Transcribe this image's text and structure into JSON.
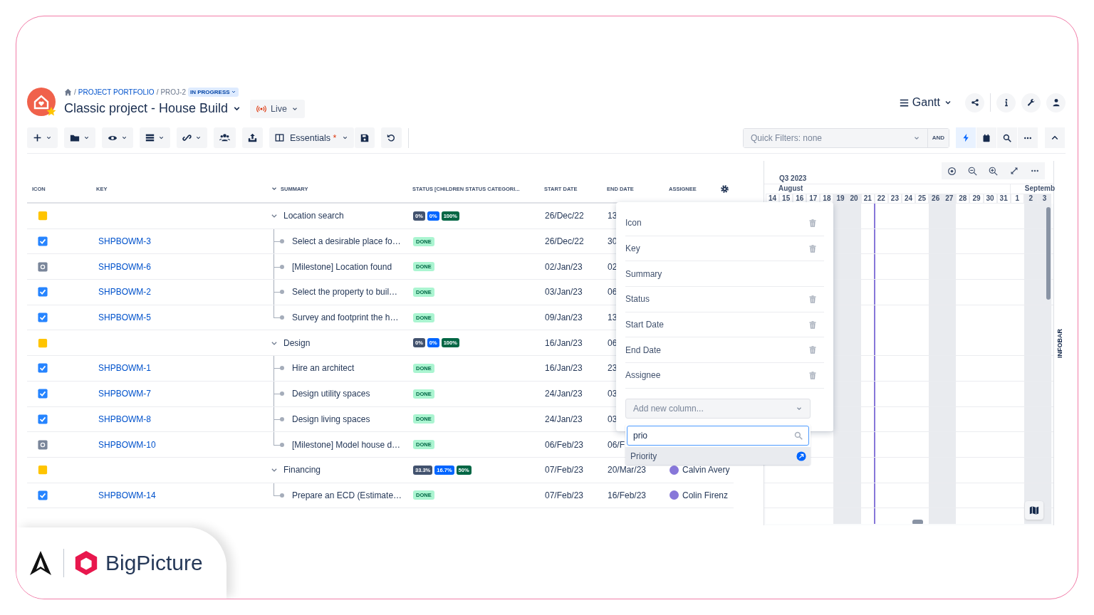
{
  "breadcrumb": {
    "separator": "/",
    "items": [
      "PROJECT PORTFOLIO",
      "PROJ-2"
    ],
    "status": "IN PROGRESS"
  },
  "project": {
    "title": "Classic project - House Build",
    "mode": "Live"
  },
  "view": {
    "label": "Gantt"
  },
  "toolbar": {
    "view_button": "Essentials",
    "view_modified": "*",
    "quick_filters_placeholder": "Quick Filters: none",
    "logic": "AND"
  },
  "table": {
    "columns": [
      {
        "label": "ICON"
      },
      {
        "label": "KEY"
      },
      {
        "label": "SUMMARY"
      },
      {
        "label": "STATUS [CHILDREN STATUS CATEGORI..."
      },
      {
        "label": "START DATE"
      },
      {
        "label": "END DATE"
      },
      {
        "label": "ASSIGNEE"
      }
    ],
    "rows": [
      {
        "kind": "group",
        "summary": "Location search",
        "expanded": true,
        "progress": [
          {
            "text": "0%",
            "color": "#42526e"
          },
          {
            "text": "0%",
            "color": "#0065ff"
          },
          {
            "text": "100%",
            "color": "#006644"
          }
        ],
        "start": "26/Dec/22",
        "end": "13",
        "children": [
          {
            "kind": "task",
            "key": "SHPBOWM-3",
            "summary": "Select a desirable place fo…",
            "status": "DONE",
            "start": "26/Dec/22",
            "end": "30"
          },
          {
            "kind": "milestone",
            "key": "SHPBOWM-6",
            "summary": "[Milestone] Location found",
            "status": "DONE",
            "start": "02/Jan/23",
            "end": "02"
          },
          {
            "kind": "task",
            "key": "SHPBOWM-2",
            "summary": "Select the property to buil…",
            "status": "DONE",
            "start": "03/Jan/23",
            "end": "06"
          },
          {
            "kind": "task",
            "key": "SHPBOWM-5",
            "summary": "Survey and footprint the h…",
            "status": "DONE",
            "start": "09/Jan/23",
            "end": "13"
          }
        ]
      },
      {
        "kind": "group",
        "summary": "Design",
        "expanded": true,
        "progress": [
          {
            "text": "0%",
            "color": "#42526e"
          },
          {
            "text": "0%",
            "color": "#0065ff"
          },
          {
            "text": "100%",
            "color": "#006644"
          }
        ],
        "start": "16/Jan/23",
        "end": "06",
        "children": [
          {
            "kind": "task",
            "key": "SHPBOWM-1",
            "summary": "Hire an architect",
            "status": "DONE",
            "start": "16/Jan/23",
            "end": "23"
          },
          {
            "kind": "task",
            "key": "SHPBOWM-7",
            "summary": "Design utility spaces",
            "status": "DONE",
            "start": "24/Jan/23",
            "end": "03"
          },
          {
            "kind": "task",
            "key": "SHPBOWM-8",
            "summary": "Design living spaces",
            "status": "DONE",
            "start": "24/Jan/23",
            "end": "03"
          },
          {
            "kind": "milestone",
            "key": "SHPBOWM-10",
            "summary": "[Milestone] Model house d…",
            "status": "DONE",
            "start": "06/Feb/23",
            "end": "06/F"
          }
        ]
      },
      {
        "kind": "group",
        "summary": "Financing",
        "expanded": true,
        "progress": [
          {
            "text": "33.3%",
            "color": "#42526e"
          },
          {
            "text": "16.7%",
            "color": "#0065ff"
          },
          {
            "text": "50%",
            "color": "#006644"
          }
        ],
        "start": "07/Feb/23",
        "end": "20/Mar/23",
        "assignee": "Calvin Avery",
        "children": [
          {
            "kind": "task",
            "key": "SHPBOWM-14",
            "summary": "Prepare an ECD (Estimate…",
            "status": "DONE",
            "start": "07/Feb/23",
            "end": "16/Feb/23",
            "assignee": "Colin Firenz"
          }
        ]
      }
    ]
  },
  "column_picker": {
    "items": [
      {
        "label": "Icon",
        "removable": true
      },
      {
        "label": "Key",
        "removable": true
      },
      {
        "label": "Summary",
        "removable": false
      },
      {
        "label": "Status",
        "removable": true
      },
      {
        "label": "Start Date",
        "removable": true
      },
      {
        "label": "End Date",
        "removable": true
      },
      {
        "label": "Assignee",
        "removable": true
      }
    ],
    "add_placeholder": "Add new column...",
    "search_value": "prio",
    "options": [
      {
        "label": "Priority",
        "selected": true
      }
    ]
  },
  "gantt": {
    "quarter": "Q3 2023",
    "months": [
      {
        "label": "August",
        "days": [
          {
            "label": "14",
            "weekend": false,
            "today": false
          },
          {
            "label": "15",
            "weekend": false,
            "today": false
          },
          {
            "label": "16",
            "weekend": false,
            "today": false
          },
          {
            "label": "17",
            "weekend": false,
            "today": false
          },
          {
            "label": "18",
            "weekend": false,
            "today": false
          },
          {
            "label": "19",
            "weekend": true,
            "today": false
          },
          {
            "label": "20",
            "weekend": true,
            "today": false
          },
          {
            "label": "21",
            "weekend": false,
            "today": false
          },
          {
            "label": "22",
            "weekend": false,
            "today": true
          },
          {
            "label": "23",
            "weekend": false,
            "today": false
          },
          {
            "label": "24",
            "weekend": false,
            "today": false
          },
          {
            "label": "25",
            "weekend": false,
            "today": false
          },
          {
            "label": "26",
            "weekend": true,
            "today": false
          },
          {
            "label": "27",
            "weekend": true,
            "today": false
          },
          {
            "label": "28",
            "weekend": false,
            "today": false
          },
          {
            "label": "29",
            "weekend": false,
            "today": false
          },
          {
            "label": "30",
            "weekend": false,
            "today": false
          },
          {
            "label": "31",
            "weekend": false,
            "today": false
          }
        ]
      },
      {
        "label": "Septemb",
        "days": [
          {
            "label": "1",
            "weekend": false,
            "today": false
          },
          {
            "label": "2",
            "weekend": true,
            "today": false
          },
          {
            "label": "3",
            "weekend": true,
            "today": false
          }
        ]
      }
    ]
  },
  "infobar": {
    "label": "INFOBAR"
  },
  "branding": {
    "name": "BigPicture"
  }
}
